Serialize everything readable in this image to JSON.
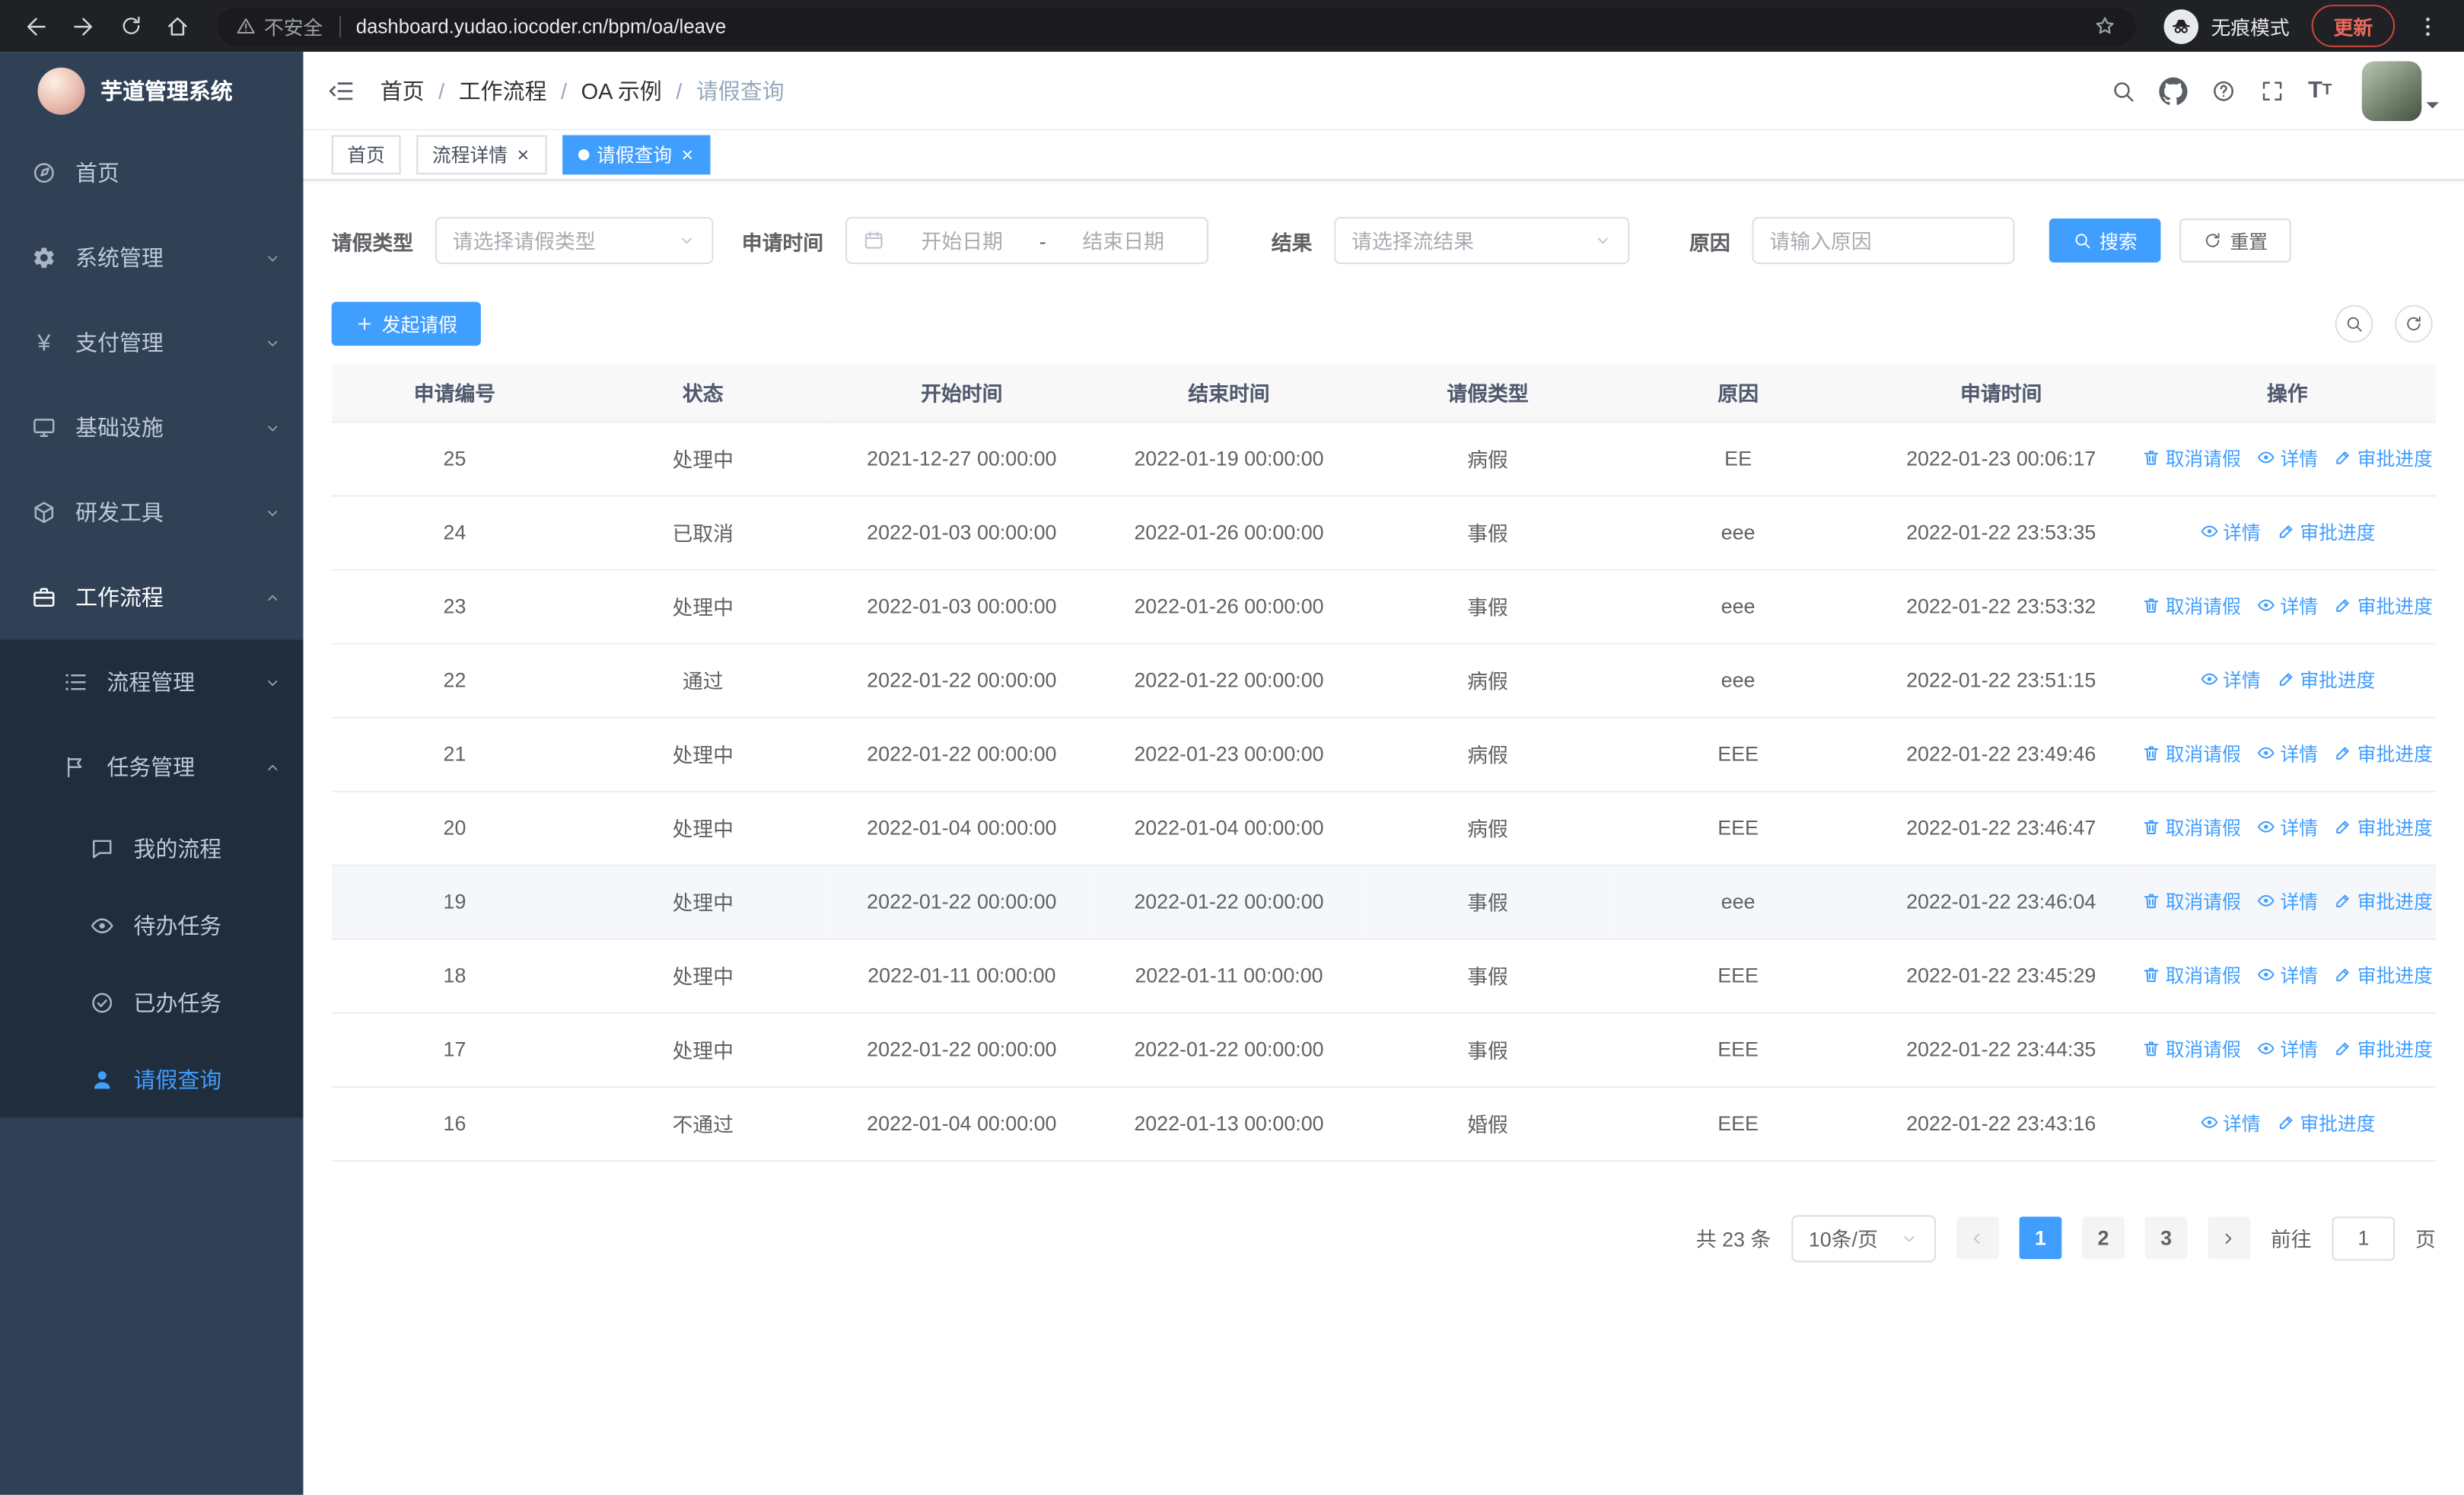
{
  "browser": {
    "security_label": "不安全",
    "url": "dashboard.yudao.iocoder.cn/bpm/oa/leave",
    "incognito_label": "无痕模式",
    "update_label": "更新"
  },
  "sidebar": {
    "logo_title": "芋道管理系统",
    "menu": {
      "home": "首页",
      "system": "系统管理",
      "pay": "支付管理",
      "infra": "基础设施",
      "devtools": "研发工具",
      "workflow": "工作流程",
      "process": "流程管理",
      "task": "任务管理",
      "my_process": "我的流程",
      "todo_task": "待办任务",
      "done_task": "已办任务",
      "leave_query": "请假查询"
    }
  },
  "header": {
    "breadcrumb": [
      "首页",
      "工作流程",
      "OA 示例",
      "请假查询"
    ],
    "separator": "/"
  },
  "tabs": [
    {
      "label": "首页"
    },
    {
      "label": "流程详情"
    },
    {
      "label": "请假查询"
    }
  ],
  "ui": {
    "close_glyph": "×"
  },
  "filters": {
    "leave_type_label": "请假类型",
    "leave_type_placeholder": "请选择请假类型",
    "apply_time_label": "申请时间",
    "start_placeholder": "开始日期",
    "range_separator": "-",
    "end_placeholder": "结束日期",
    "result_label": "结果",
    "result_placeholder": "请选择流结果",
    "reason_label": "原因",
    "reason_placeholder": "请输入原因",
    "search_label": "搜索",
    "reset_label": "重置"
  },
  "toolbar": {
    "create_label": "发起请假"
  },
  "table": {
    "columns": [
      "申请编号",
      "状态",
      "开始时间",
      "结束时间",
      "请假类型",
      "原因",
      "申请时间",
      "操作"
    ],
    "ops": {
      "cancel": "取消请假",
      "detail": "详情",
      "progress": "审批进度"
    },
    "rows": [
      {
        "id": "25",
        "status": "处理中",
        "start": "2021-12-27 00:00:00",
        "end": "2022-01-19 00:00:00",
        "type": "病假",
        "reason": "EE",
        "apply_time": "2022-01-23 00:06:17",
        "can_cancel": true
      },
      {
        "id": "24",
        "status": "已取消",
        "start": "2022-01-03 00:00:00",
        "end": "2022-01-26 00:00:00",
        "type": "事假",
        "reason": "eee",
        "apply_time": "2022-01-22 23:53:35",
        "can_cancel": false
      },
      {
        "id": "23",
        "status": "处理中",
        "start": "2022-01-03 00:00:00",
        "end": "2022-01-26 00:00:00",
        "type": "事假",
        "reason": "eee",
        "apply_time": "2022-01-22 23:53:32",
        "can_cancel": true
      },
      {
        "id": "22",
        "status": "通过",
        "start": "2022-01-22 00:00:00",
        "end": "2022-01-22 00:00:00",
        "type": "病假",
        "reason": "eee",
        "apply_time": "2022-01-22 23:51:15",
        "can_cancel": false
      },
      {
        "id": "21",
        "status": "处理中",
        "start": "2022-01-22 00:00:00",
        "end": "2022-01-23 00:00:00",
        "type": "病假",
        "reason": "EEE",
        "apply_time": "2022-01-22 23:49:46",
        "can_cancel": true
      },
      {
        "id": "20",
        "status": "处理中",
        "start": "2022-01-04 00:00:00",
        "end": "2022-01-04 00:00:00",
        "type": "病假",
        "reason": "EEE",
        "apply_time": "2022-01-22 23:46:47",
        "can_cancel": true
      },
      {
        "id": "19",
        "status": "处理中",
        "start": "2022-01-22 00:00:00",
        "end": "2022-01-22 00:00:00",
        "type": "事假",
        "reason": "eee",
        "apply_time": "2022-01-22 23:46:04",
        "can_cancel": true,
        "highlight": true
      },
      {
        "id": "18",
        "status": "处理中",
        "start": "2022-01-11 00:00:00",
        "end": "2022-01-11 00:00:00",
        "type": "事假",
        "reason": "EEE",
        "apply_time": "2022-01-22 23:45:29",
        "can_cancel": true
      },
      {
        "id": "17",
        "status": "处理中",
        "start": "2022-01-22 00:00:00",
        "end": "2022-01-22 00:00:00",
        "type": "事假",
        "reason": "EEE",
        "apply_time": "2022-01-22 23:44:35",
        "can_cancel": true
      },
      {
        "id": "16",
        "status": "不通过",
        "start": "2022-01-04 00:00:00",
        "end": "2022-01-13 00:00:00",
        "type": "婚假",
        "reason": "EEE",
        "apply_time": "2022-01-22 23:43:16",
        "can_cancel": false
      }
    ]
  },
  "pagination": {
    "total_label": "共 23 条",
    "page_size": "10条/页",
    "pages": [
      "1",
      "2",
      "3"
    ],
    "goto_label": "前往",
    "goto_value": "1",
    "page_unit": "页"
  },
  "colors": {
    "primary": "#409eff",
    "sidebar_bg": "#304156",
    "submenu_bg": "#1f2d3d"
  }
}
